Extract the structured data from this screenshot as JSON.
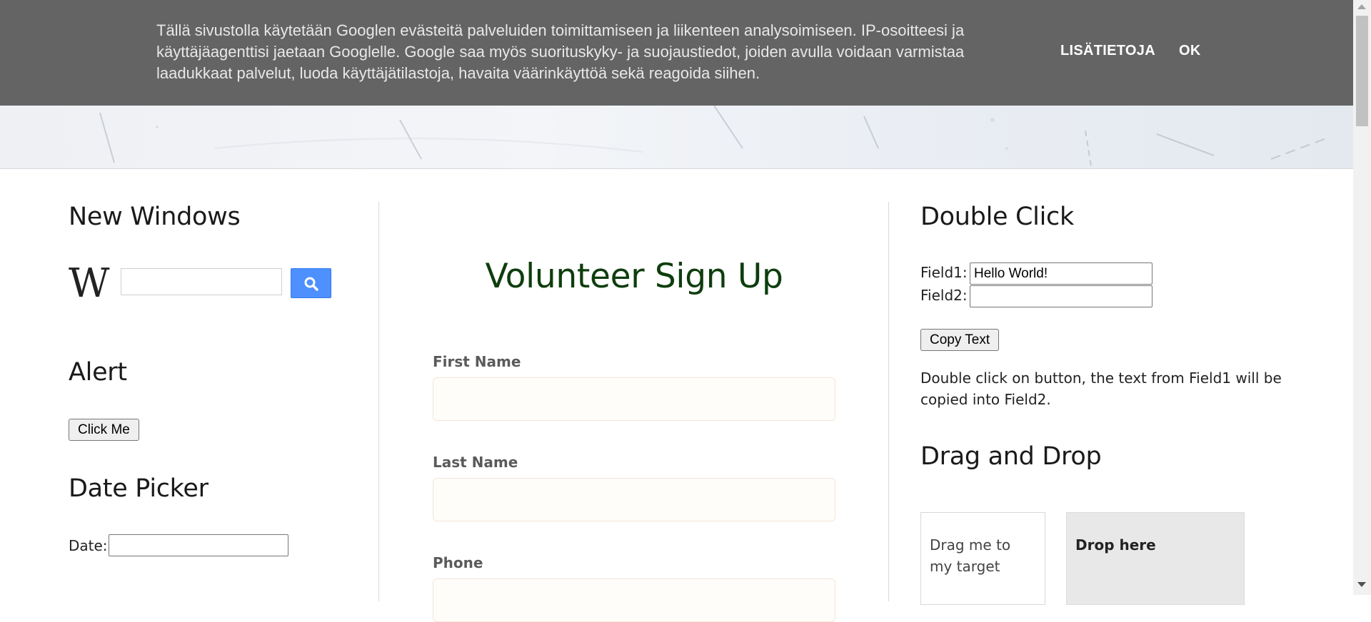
{
  "cookie_banner": {
    "text": "Tällä sivustolla käytetään Googlen evästeitä palveluiden toimittamiseen ja liikenteen analysoimiseen. IP-osoitteesi ja käyttäjäagenttisi jaetaan Googlelle. Google saa myös suorituskyky- ja suojaustiedot, joiden avulla voidaan varmistaa laadukkaat palvelut, luoda käyttäjätilastoja, havaita väärinkäyttöä sekä reagoida siihen.",
    "more_label": "LISÄTIETOJA",
    "ok_label": "OK"
  },
  "left": {
    "new_windows_heading": "New Windows",
    "wiki_logo": "W",
    "wiki_search_value": "",
    "alert_heading": "Alert",
    "alert_button": "Click Me",
    "date_picker_heading": "Date Picker",
    "date_label": "Date:",
    "date_value": ""
  },
  "middle": {
    "title": "Volunteer Sign Up",
    "first_name_label": "First Name",
    "last_name_label": "Last Name",
    "phone_label": "Phone"
  },
  "right": {
    "double_click_heading": "Double Click",
    "field1_label": "Field1:",
    "field1_value": "Hello World!",
    "field2_label": "Field2:",
    "field2_value": "",
    "copy_button": "Copy Text",
    "instruction": "Double click on button, the text from Field1 will be copied into Field2.",
    "drag_drop_heading": "Drag and Drop",
    "drag_text": "Drag me to my target",
    "drop_text": "Drop here"
  },
  "colors": {
    "banner_bg": "#646464",
    "search_button": "#4d90fe",
    "form_title": "#0e3d0e",
    "drop_bg": "#e8e8e8"
  },
  "icons": [
    "search-icon",
    "wikipedia-logo",
    "scroll-up-arrow",
    "scroll-down-arrow"
  ]
}
